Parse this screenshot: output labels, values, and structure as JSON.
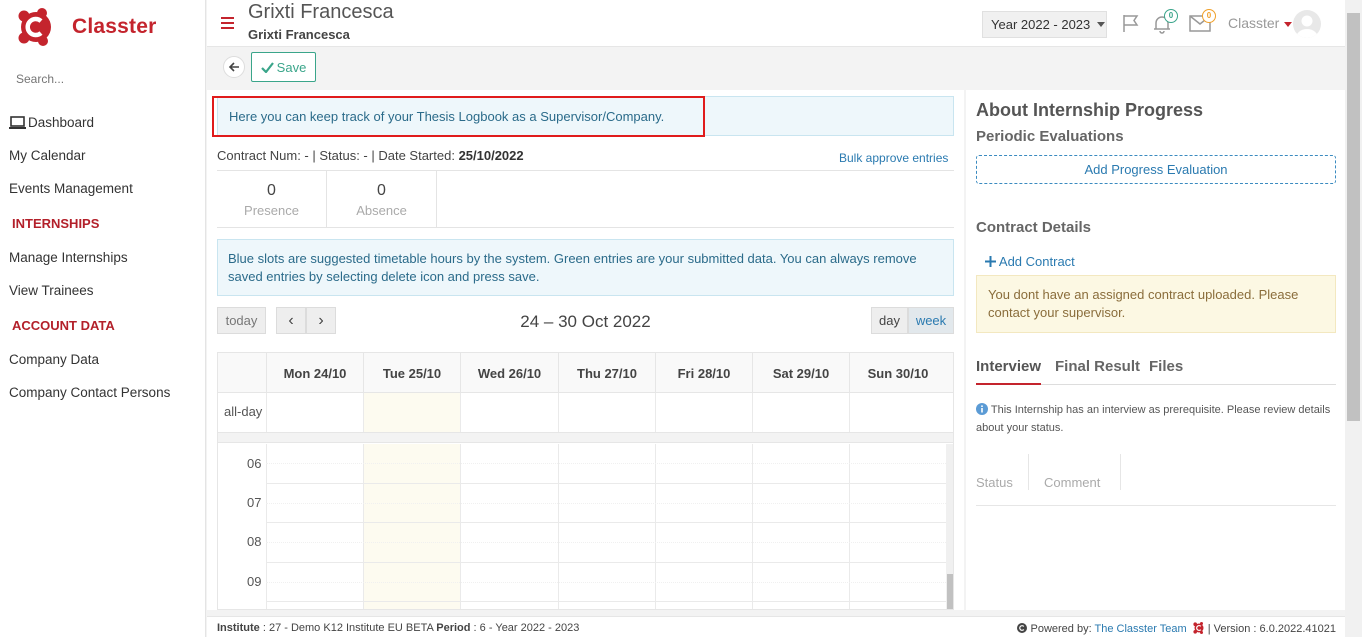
{
  "app": {
    "name": "Classter",
    "brand_color": "#c4242d"
  },
  "sidebar": {
    "search_placeholder": "Search...",
    "items": [
      {
        "label": "Dashboard"
      },
      {
        "label": "My Calendar"
      },
      {
        "label": "Events Management"
      }
    ],
    "internships_section": "INTERNSHIPS",
    "internships_items": [
      {
        "label": "Manage Internships"
      },
      {
        "label": "View Trainees"
      }
    ],
    "account_section": "ACCOUNT DATA",
    "account_items": [
      {
        "label": "Company Data"
      },
      {
        "label": "Company Contact Persons"
      }
    ]
  },
  "header": {
    "title": "Grixti Francesca",
    "subtitle": "Grixti Francesca",
    "year": "Year 2022 - 2023",
    "notifications_count": "0",
    "messages_count": "0",
    "user": "Classter"
  },
  "toolbar": {
    "save_label": "Save"
  },
  "main": {
    "info_text": "Here you can keep track of your Thesis Logbook as a Supervisor/Company.",
    "contract_prefix": "Contract Num: -   | Status: - | Date Started: ",
    "date_started": "25/10/2022",
    "bulk_approve": "Bulk approve entries",
    "presence_value": "0",
    "presence_label": "Presence",
    "absence_value": "0",
    "absence_label": "Absence",
    "slots_info": "Blue slots are suggested timetable hours by the system. Green entries are your submitted data. You can always remove saved entries by selecting delete icon and press save."
  },
  "calendar": {
    "today_label": "today",
    "prev": "‹",
    "next": "›",
    "title": "24 – 30 Oct 2022",
    "day_label": "day",
    "week_label": "week",
    "days": [
      "Mon 24/10",
      "Tue 25/10",
      "Wed 26/10",
      "Thu 27/10",
      "Fri 28/10",
      "Sat 29/10",
      "Sun 30/10"
    ],
    "allday_label": "all-day",
    "hours": [
      "06",
      "07",
      "08",
      "09"
    ]
  },
  "right": {
    "title": "About Internship Progress",
    "periodic": "Periodic Evaluations",
    "add_eval": "Add Progress Evaluation",
    "contract_details": "Contract Details",
    "add_contract": "Add Contract",
    "no_contract": "You dont have an assigned contract uploaded. Please contact your supervisor.",
    "tabs": [
      "Interview",
      "Final Result",
      "Files"
    ],
    "interview_note": "This Internship has an interview as prerequisite. Please review details about your status.",
    "col_status": "Status",
    "col_comment": "Comment"
  },
  "footer": {
    "institute_label": "Institute",
    "institute_value": " : 27 - Demo K12 Institute EU BETA ",
    "period_label": "Period",
    "period_value": " : 6 - Year 2022 - 2023",
    "powered_by": "Powered by: ",
    "team": "The Classter Team",
    "version": " | Version : 6.0.2022.41021"
  }
}
